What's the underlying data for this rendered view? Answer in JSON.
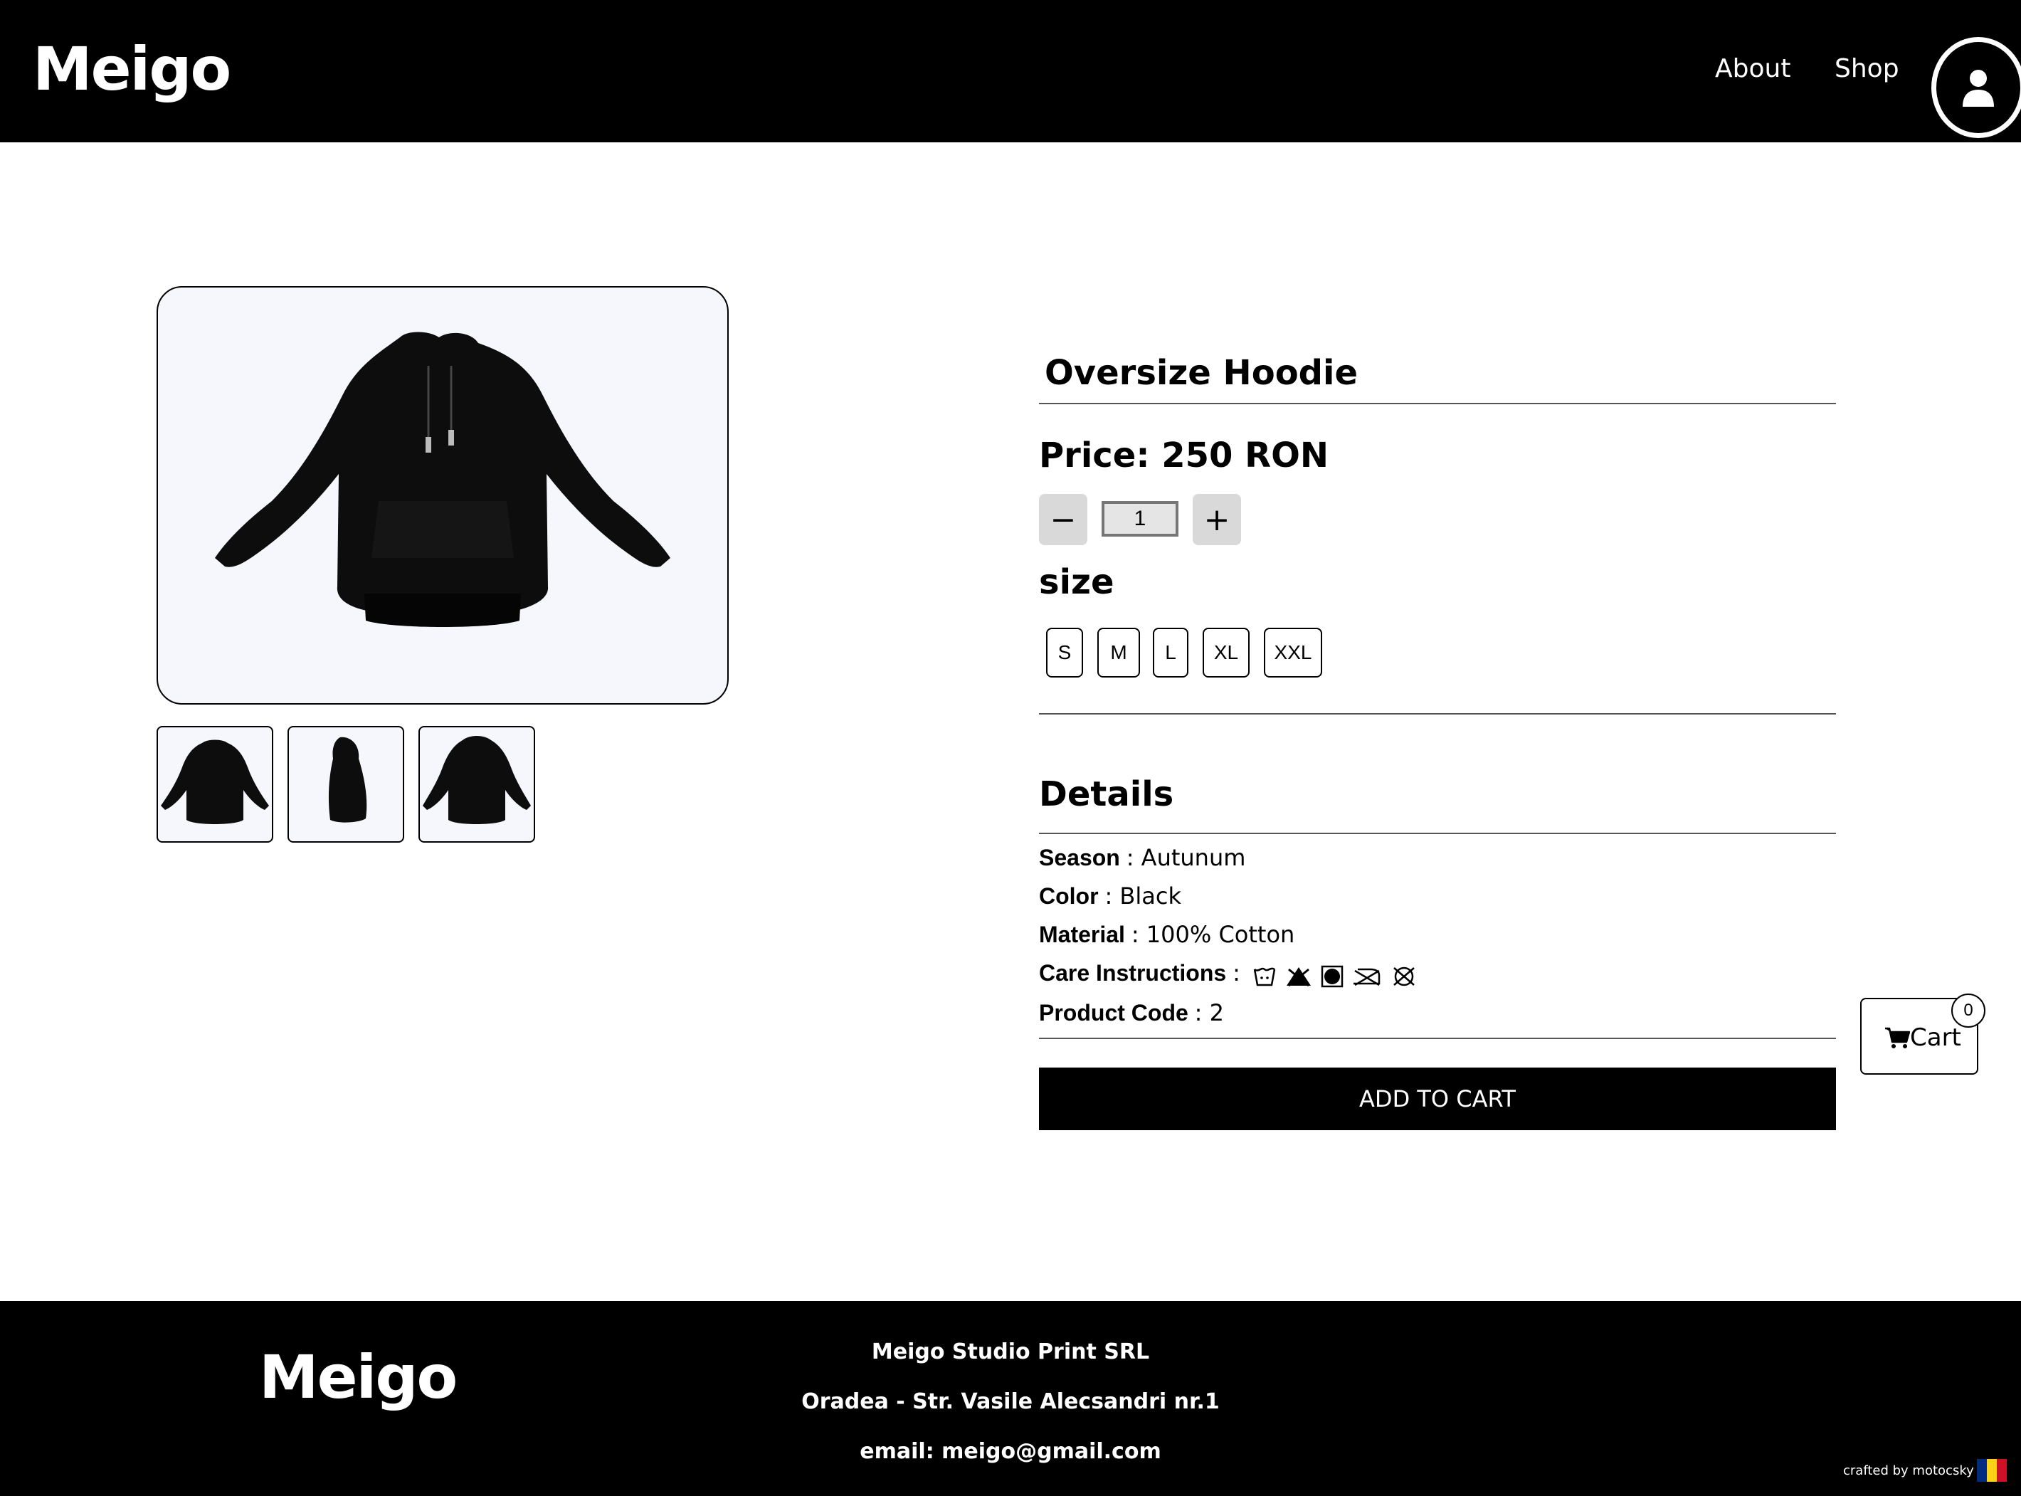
{
  "header": {
    "logo": "Meigo",
    "nav": [
      {
        "label": "About"
      },
      {
        "label": "Shop"
      }
    ],
    "account_icon": "user-circle-icon"
  },
  "product": {
    "title": "Oversize Hoodie",
    "price": "Price: 250 RON",
    "quantity": {
      "minus": "−",
      "value": "1",
      "plus": "+"
    },
    "size_label": "size",
    "sizes": [
      "S",
      "M",
      "L",
      "XL",
      "XXL"
    ],
    "images": {
      "main": "hoodie-front-image",
      "thumbnails": [
        "hoodie-front-thumb",
        "hoodie-side-thumb",
        "hoodie-back-thumb"
      ]
    }
  },
  "details": {
    "title": "Details",
    "rows": [
      {
        "label": "Season",
        "value": ": Autunum"
      },
      {
        "label": "Color",
        "value": ": Black"
      },
      {
        "label": "Material",
        "value": ": 100% Cotton"
      },
      {
        "label": "Care Instructions",
        "value": ":"
      },
      {
        "label": "Product Code",
        "value": ": 2"
      }
    ],
    "care_icons": [
      "wash-30-icon",
      "no-bleach-icon",
      "tumble-dry-icon",
      "iron-low-icon",
      "no-dry-clean-icon"
    ]
  },
  "add_to_cart": "ADD TO CART",
  "cart": {
    "label": "Cart",
    "count": "0",
    "icon": "cart-icon"
  },
  "footer": {
    "logo": "Meigo",
    "company": "Meigo Studio Print SRL",
    "address": "Oradea - Str. Vasile Alecsandri nr.1",
    "email": "email: meigo@gmail.com",
    "credit": "crafted by motocsky",
    "flag_colors": [
      "#002b7f",
      "#fcd116",
      "#ce1126"
    ]
  },
  "colors": {
    "header_bg": "#000000",
    "footer_bg": "#000000",
    "image_bg": "#f5f7fc",
    "qty_button_bg": "#d9d9d9"
  }
}
